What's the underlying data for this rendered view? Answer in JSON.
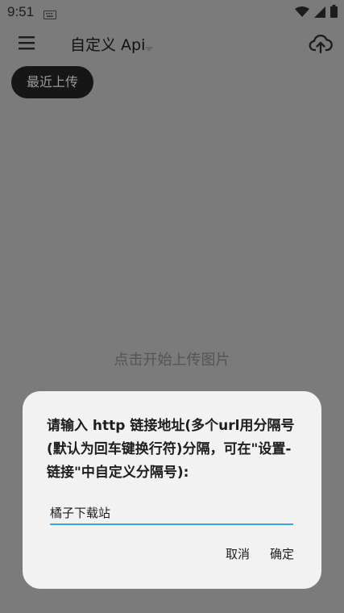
{
  "status": {
    "time": "9:51",
    "icons": [
      "keyboard-icon",
      "wifi-icon",
      "signal-icon",
      "battery-icon"
    ]
  },
  "app_bar": {
    "title": "自定义 Api",
    "icons": [
      "menu-icon",
      "dropdown-caret-icon",
      "cloud-upload-icon"
    ]
  },
  "recent_upload_label": "最近上传",
  "center_hint": "点击开始上传图片",
  "dialog": {
    "message": "请输入 http 链接地址(多个url用分隔号(默认为回车键换行符)分隔，可在\"设置-链接\"中自定义分隔号):",
    "input_value": "橘子下载站",
    "cancel_label": "取消",
    "confirm_label": "确定"
  },
  "colors": {
    "scrim": "#7b7b7b",
    "dialog_bg": "#f2f2f2",
    "input_underline": "#3aa6e0",
    "recent_button_bg": "#161616"
  }
}
